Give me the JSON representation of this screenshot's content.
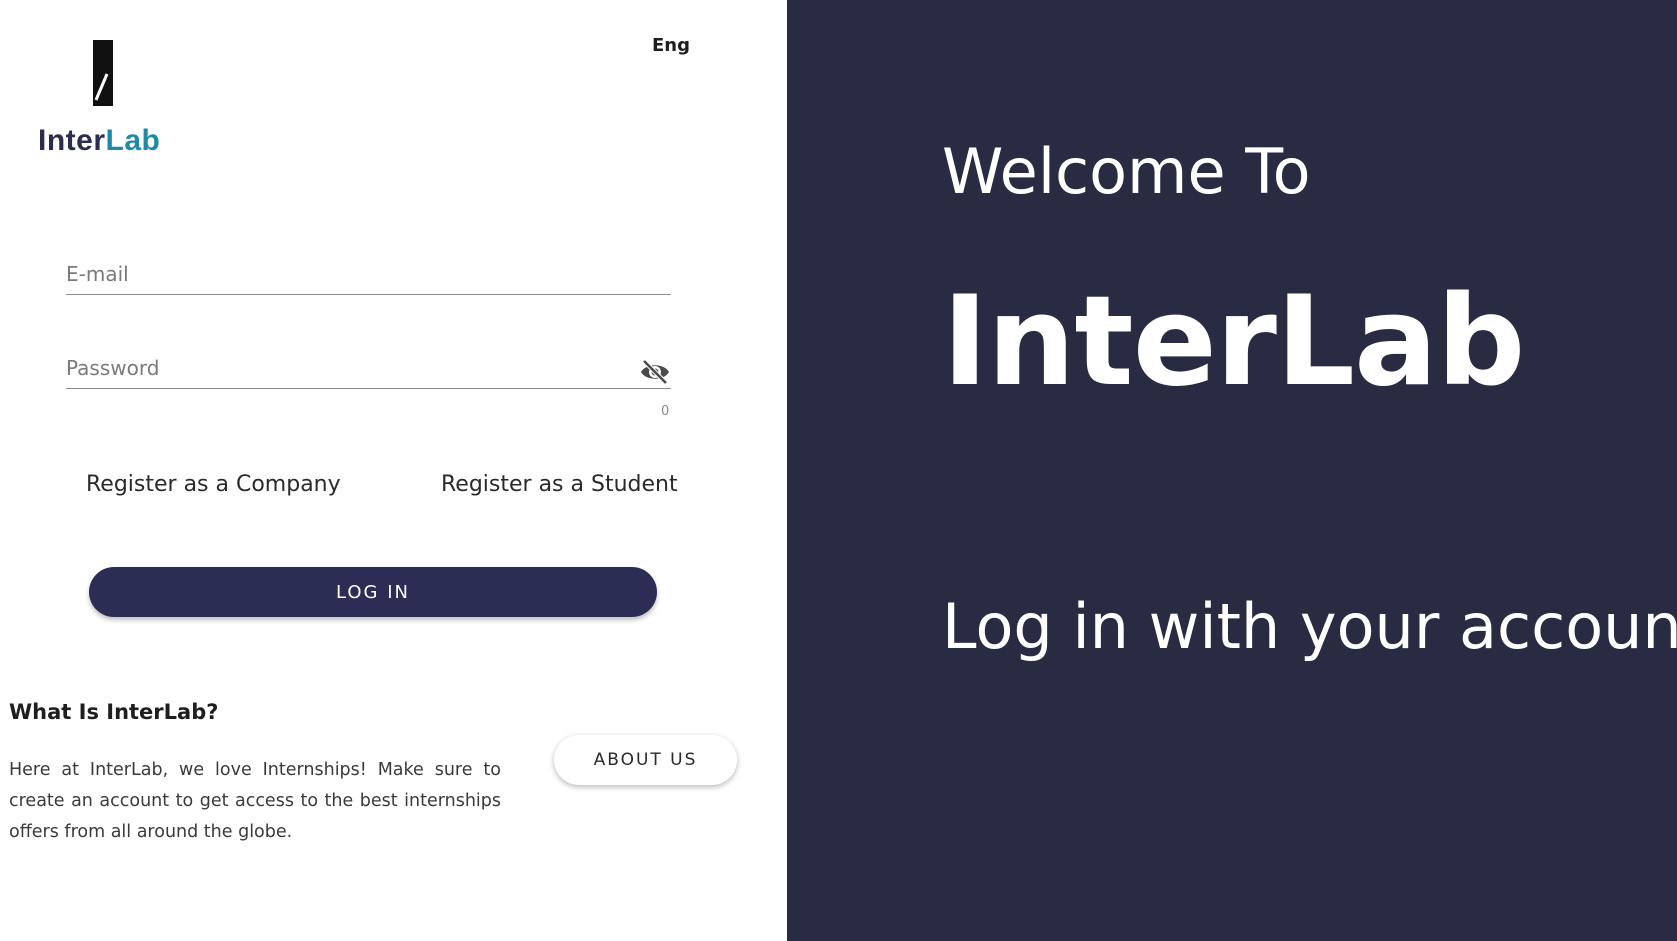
{
  "logo": {
    "text_part1": "Inter",
    "text_part2": "Lab",
    "colors": {
      "dark": "#2b2d4e",
      "accent": "#1f8aa8"
    }
  },
  "language": {
    "label": "Eng"
  },
  "form": {
    "email_placeholder": "E-mail",
    "password_placeholder": "Password",
    "password_counter": "0",
    "visibility_icon": "eye-off-icon",
    "register_company_label": "Register as a Company",
    "register_student_label": "Register as a Student",
    "login_label": "LOG IN"
  },
  "about": {
    "title": "What Is InterLab?",
    "text": "Here at InterLab, we love Internships! Make sure to create an account to get access to the best internships offers from all around the globe.",
    "button_label": "ABOUT US"
  },
  "hero": {
    "welcome": "Welcome To",
    "brand": "InterLab",
    "subline": "Log in with your account"
  },
  "colors": {
    "panel_background": "#292b42",
    "button_primary": "#2c2d55"
  }
}
